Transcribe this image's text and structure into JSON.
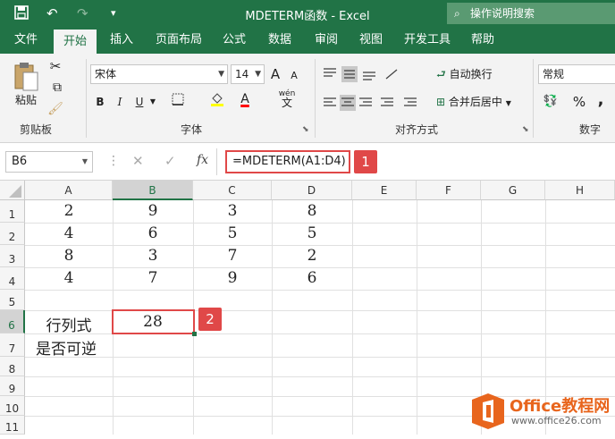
{
  "app": {
    "title": "MDETERM函数  -  Excel",
    "tell_me": "操作说明搜索",
    "qat": {
      "save_icon": "save-icon",
      "undo": "↶",
      "redo": "↷",
      "customize": "▾"
    }
  },
  "tabs": [
    "文件",
    "开始",
    "插入",
    "页面布局",
    "公式",
    "数据",
    "审阅",
    "视图",
    "开发工具",
    "帮助"
  ],
  "active_tab": "开始",
  "ribbon": {
    "clipboard": {
      "paste": "粘贴",
      "label": "剪贴板"
    },
    "font": {
      "name": "宋体",
      "size": "14",
      "bold": "B",
      "italic": "I",
      "underline": "U",
      "grow": "A",
      "shrink": "A",
      "font_color": "A",
      "wen": "wén",
      "wen_char": "文",
      "label": "字体"
    },
    "alignment": {
      "wrap": "自动换行",
      "merge": "合并后居中",
      "label": "对齐方式"
    },
    "number": {
      "format": "常规",
      "percent": "%",
      "comma": ",",
      "label": "数字"
    }
  },
  "formula_bar": {
    "name_box": "B6",
    "cancel": "✕",
    "enter": "✓",
    "fx": "fx",
    "formula": "=MDETERM(A1:D4)"
  },
  "callouts": [
    "1",
    "2"
  ],
  "columns": [
    "A",
    "B",
    "C",
    "D",
    "E",
    "F",
    "G",
    "H"
  ],
  "rows": [
    "1",
    "2",
    "3",
    "4",
    "5",
    "6",
    "7",
    "8",
    "9",
    "10",
    "11"
  ],
  "cells": {
    "row1": [
      "2",
      "9",
      "3",
      "8"
    ],
    "row2": [
      "4",
      "6",
      "5",
      "5"
    ],
    "row3": [
      "8",
      "3",
      "7",
      "2"
    ],
    "row4": [
      "4",
      "7",
      "9",
      "6"
    ],
    "A6": "行列式",
    "B6": "28",
    "A7": "是否可逆"
  },
  "selected_cell": "B6",
  "watermark": {
    "brand": "Office教程网",
    "url": "www.office26.com"
  },
  "colors": {
    "excel_green": "#217346",
    "callout_red": "#e04848",
    "watermark_orange": "#e8651d"
  }
}
